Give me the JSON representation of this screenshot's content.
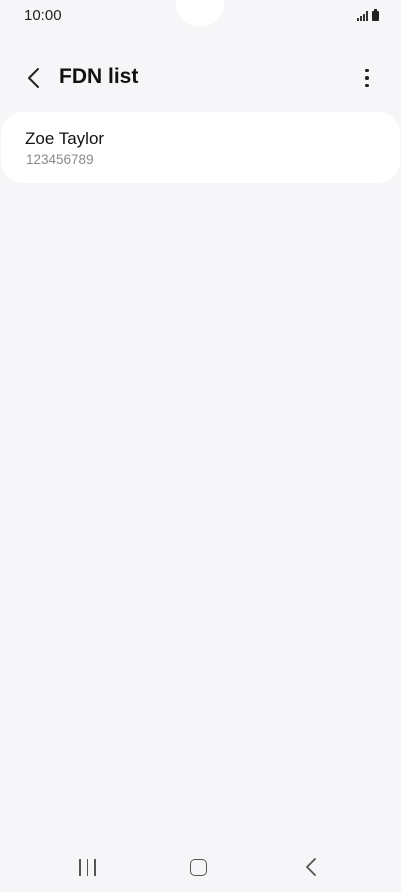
{
  "status_bar": {
    "time": "10:00",
    "icons": [
      "signal-icon",
      "battery-icon"
    ]
  },
  "app_bar": {
    "title": "FDN list",
    "back_icon": "back-chevron-icon",
    "more_icon": "more-options-icon"
  },
  "fdn_list": {
    "contacts": [
      {
        "name": "Zoe Taylor",
        "number": "123456789"
      }
    ]
  },
  "nav_bar": {
    "icons": [
      "recents-icon",
      "home-icon",
      "back-icon"
    ]
  },
  "colors": {
    "background": "#f6f6f8",
    "card": "#ffffff",
    "secondary_text": "#8a8a8a"
  }
}
